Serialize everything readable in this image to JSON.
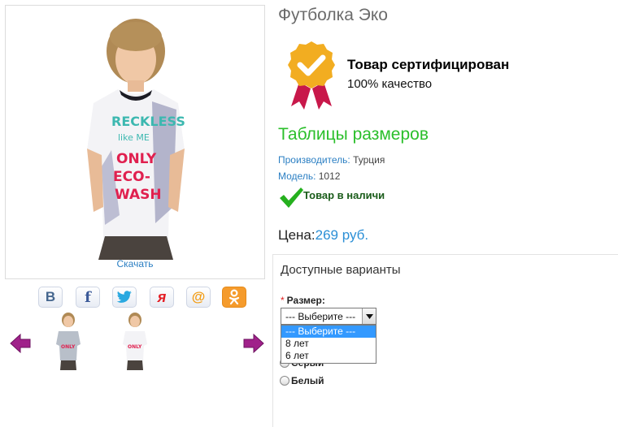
{
  "product": {
    "title": "Футболка Эко",
    "download_label": "Скачать"
  },
  "certificate": {
    "title": "Товар сертифицирован",
    "subtitle": "100% качество"
  },
  "size_table_link": "Таблицы размеров",
  "manufacturer": {
    "label": "Производитель:",
    "value": "Турция"
  },
  "model": {
    "label": "Модель:",
    "value": "1012"
  },
  "stock_status": "Товар в наличи",
  "price": {
    "label": "Цена:",
    "value": "269 руб."
  },
  "options": {
    "heading": "Доступные варианты",
    "size_required_mark": "*",
    "size_label": "Размер:",
    "size_selected": "--- Выберите ---",
    "size_options": [
      "--- Выберите ---",
      "8 лет",
      "6 лет"
    ],
    "color_options": [
      "Серый",
      "Белый"
    ]
  },
  "share_buttons": [
    {
      "icon": "vk-icon",
      "glyph": "В",
      "color": "#45668e"
    },
    {
      "icon": "facebook-icon",
      "glyph": "f",
      "color": "#3b5998"
    },
    {
      "icon": "twitter-icon",
      "glyph": "🐦",
      "color": "#29a8e0"
    },
    {
      "icon": "yaru-icon",
      "glyph": "я",
      "color": "#e41e25"
    },
    {
      "icon": "mail-icon",
      "glyph": "@",
      "color": "#f39c12"
    },
    {
      "icon": "odnoklassniki-icon",
      "glyph": "ok",
      "color": "#ffffff"
    }
  ],
  "colors": {
    "accent_green": "#2bbf2b",
    "link_blue": "#2b7fc3",
    "price_blue": "#2b8fd6",
    "arrow_purple": "#a0218a",
    "badge_gold": "#f2ad21",
    "ribbon_red": "#c8184a"
  }
}
